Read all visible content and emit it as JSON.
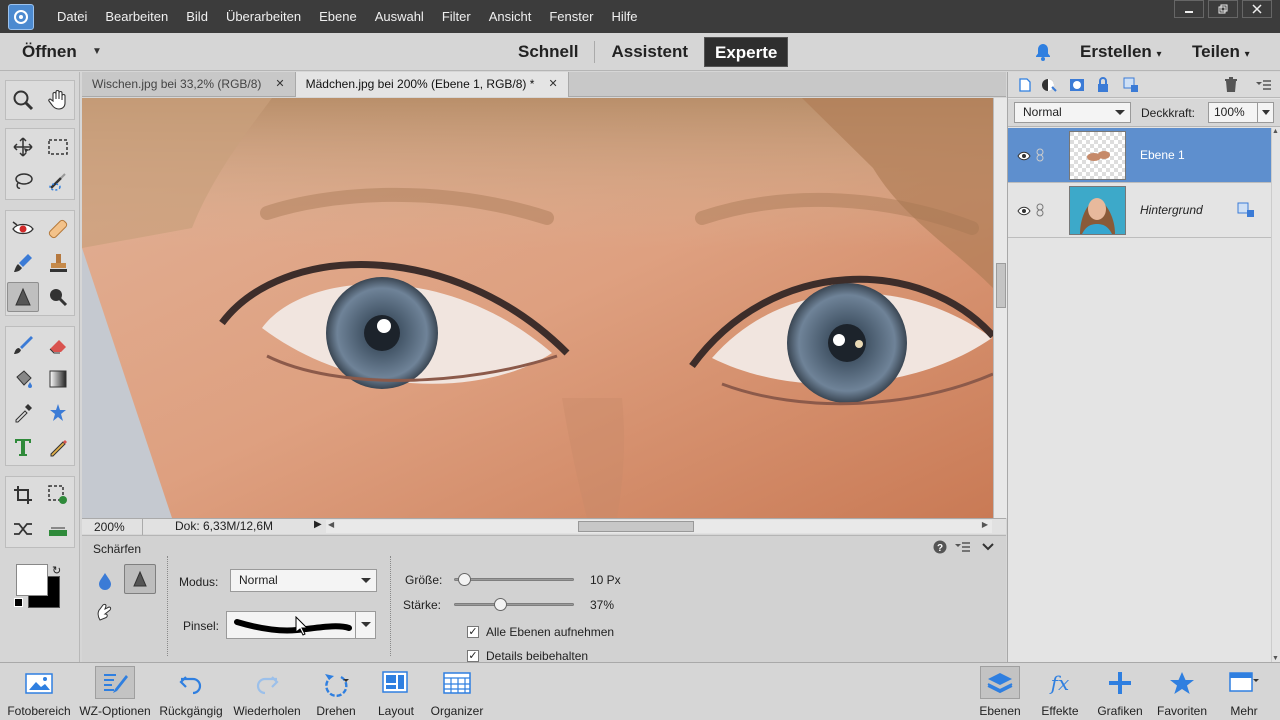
{
  "menubar": {
    "items": [
      "Datei",
      "Bearbeiten",
      "Bild",
      "Überarbeiten",
      "Ebene",
      "Auswahl",
      "Filter",
      "Ansicht",
      "Fenster",
      "Hilfe"
    ]
  },
  "modebar": {
    "open_label": "Öffnen",
    "modes": [
      "Schnell",
      "Assistent",
      "Experte"
    ],
    "active_mode": "Experte",
    "create_label": "Erstellen",
    "share_label": "Teilen"
  },
  "doc_tabs": [
    {
      "label": "Wischen.jpg bei 33,2% (RGB/8)",
      "active": false
    },
    {
      "label": "Mädchen.jpg bei 200% (Ebene 1, RGB/8) *",
      "active": true
    }
  ],
  "status": {
    "zoom": "200%",
    "doc_info": "Dok: 6,33M/12,6M"
  },
  "tool_options": {
    "title": "Schärfen",
    "mode_label": "Modus:",
    "mode_value": "Normal",
    "brush_label": "Pinsel:",
    "size_label": "Größe:",
    "size_value": "10 Px",
    "size_fraction": 0.03,
    "strength_label": "Stärke:",
    "strength_value": "37%",
    "strength_fraction": 0.37,
    "sample_all_label": "Alle Ebenen aufnehmen",
    "sample_all_checked": true,
    "protect_detail_label": "Details beibehalten",
    "protect_detail_checked": true
  },
  "layers": {
    "blend_mode": "Normal",
    "opacity_label": "Deckkraft:",
    "opacity_value": "100%",
    "items": [
      {
        "name": "Ebene 1",
        "selected": true
      },
      {
        "name": "Hintergrund",
        "selected": false
      }
    ]
  },
  "taskbar": {
    "left": [
      {
        "label": "Fotobereich",
        "icon": "photo-bin-icon"
      },
      {
        "label": "WZ-Optionen",
        "icon": "tool-options-icon"
      },
      {
        "label": "Rückgängig",
        "icon": "undo-icon"
      },
      {
        "label": "Wiederholen",
        "icon": "redo-icon"
      },
      {
        "label": "Drehen",
        "icon": "rotate-icon"
      },
      {
        "label": "Layout",
        "icon": "layout-icon"
      },
      {
        "label": "Organizer",
        "icon": "organizer-icon"
      }
    ],
    "right": [
      {
        "label": "Ebenen",
        "icon": "layers-icon"
      },
      {
        "label": "Effekte",
        "icon": "effects-icon"
      },
      {
        "label": "Grafiken",
        "icon": "graphics-icon"
      },
      {
        "label": "Favoriten",
        "icon": "favorites-icon"
      },
      {
        "label": "Mehr",
        "icon": "more-icon"
      }
    ]
  },
  "colors": {
    "selected_layer": "#5e8fce",
    "accent_blue": "#3b7bd6",
    "foreground_swatch": "#ffffff",
    "background_swatch": "#000000"
  }
}
